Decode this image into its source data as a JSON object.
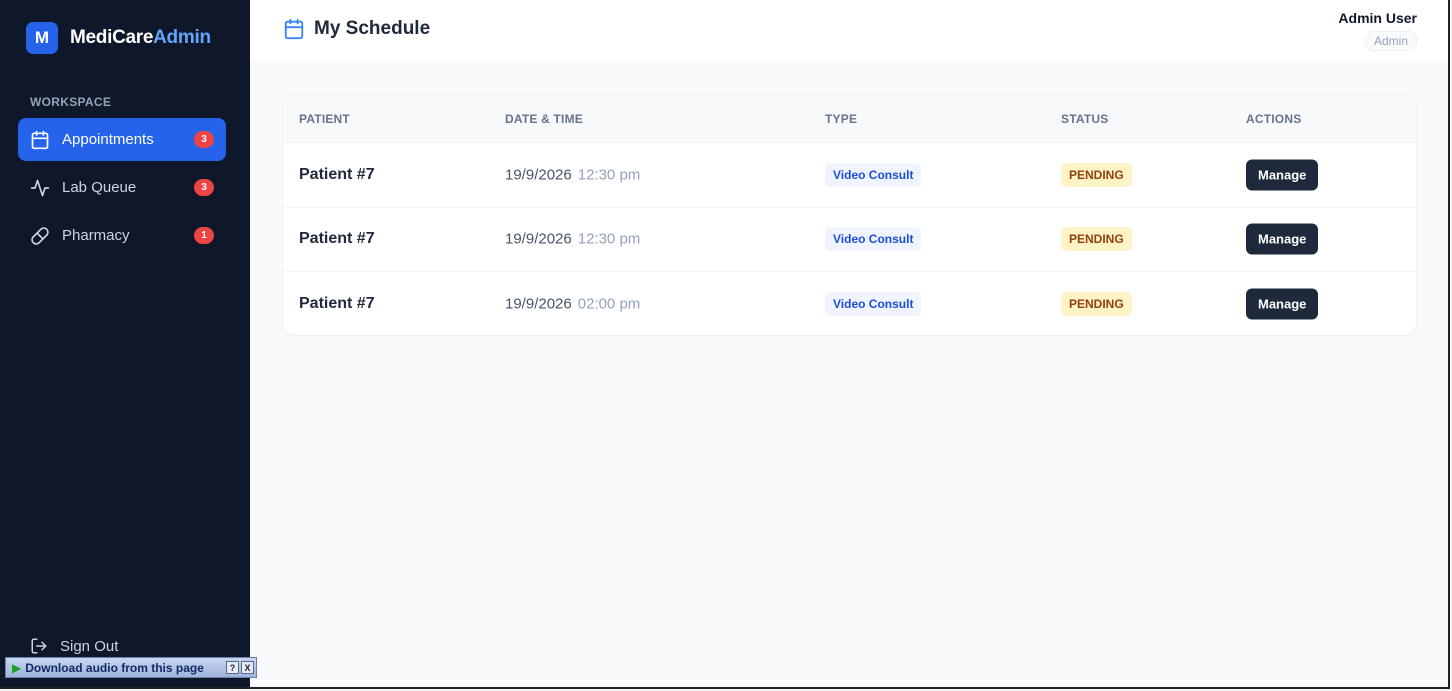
{
  "brand": {
    "logo_letter": "M",
    "name_main": "MediCare",
    "name_accent": "Admin"
  },
  "sidebar": {
    "section_label": "WORKSPACE",
    "items": [
      {
        "label": "Appointments",
        "badge": "3",
        "icon": "calendar-icon",
        "active": true
      },
      {
        "label": "Lab Queue",
        "badge": "3",
        "icon": "activity-icon",
        "active": false
      },
      {
        "label": "Pharmacy",
        "badge": "1",
        "icon": "pill-icon",
        "active": false
      }
    ],
    "signout_label": "Sign Out"
  },
  "header": {
    "title": "My Schedule",
    "user_name": "Admin User",
    "user_role": "Admin"
  },
  "table": {
    "columns": [
      "PATIENT",
      "DATE & TIME",
      "TYPE",
      "STATUS",
      "ACTIONS"
    ],
    "rows": [
      {
        "patient": "Patient #7",
        "date": "19/9/2026",
        "time": "12:30 pm",
        "type": "Video Consult",
        "status": "PENDING",
        "action": "Manage"
      },
      {
        "patient": "Patient #7",
        "date": "19/9/2026",
        "time": "12:30 pm",
        "type": "Video Consult",
        "status": "PENDING",
        "action": "Manage"
      },
      {
        "patient": "Patient #7",
        "date": "19/9/2026",
        "time": "02:00 pm",
        "type": "Video Consult",
        "status": "PENDING",
        "action": "Manage"
      }
    ]
  },
  "extension_bar": {
    "label": "Download audio from this page",
    "help": "?",
    "close": "X"
  },
  "colors": {
    "sidebar_bg": "#0f172a",
    "accent": "#2563eb",
    "badge": "#ef4444",
    "pending_bg": "#fef3c7",
    "pending_text": "#92400e",
    "type_bg": "#eff4ff",
    "type_text": "#1d4ed8",
    "button_bg": "#1e293b"
  }
}
